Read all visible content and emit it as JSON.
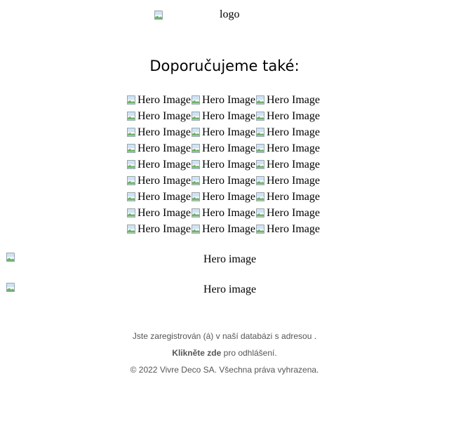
{
  "header": {
    "logo_alt": "logo"
  },
  "recommend": {
    "title": "Doporučujeme také:",
    "rows": [
      [
        "Hero Image",
        "Hero Image",
        "Hero Image"
      ],
      [
        "Hero Image",
        "Hero Image",
        "Hero Image"
      ],
      [
        "Hero Image",
        "Hero Image",
        "Hero Image"
      ],
      [
        "Hero Image",
        "Hero Image",
        "Hero Image"
      ],
      [
        "Hero Image",
        "Hero Image",
        "Hero Image"
      ],
      [
        "Hero Image",
        "Hero Image",
        "Hero Image"
      ],
      [
        "Hero Image",
        "Hero Image",
        "Hero Image"
      ],
      [
        "Hero Image",
        "Hero Image",
        "Hero Image"
      ],
      [
        "Hero Image",
        "Hero Image",
        "Hero Image"
      ]
    ]
  },
  "heroes": [
    {
      "alt": "Hero image"
    },
    {
      "alt": "Hero image"
    }
  ],
  "footer": {
    "registered_text": "Jste zaregistrován (á) v naší databázi s adresou .",
    "unsubscribe_link": "Klikněte zde",
    "unsubscribe_rest": " pro odhlášení.",
    "copyright": "© 2022 Vivre Deco SA. Všechna práva vyhrazena."
  },
  "icons": {
    "broken_image": "broken-image-icon"
  }
}
